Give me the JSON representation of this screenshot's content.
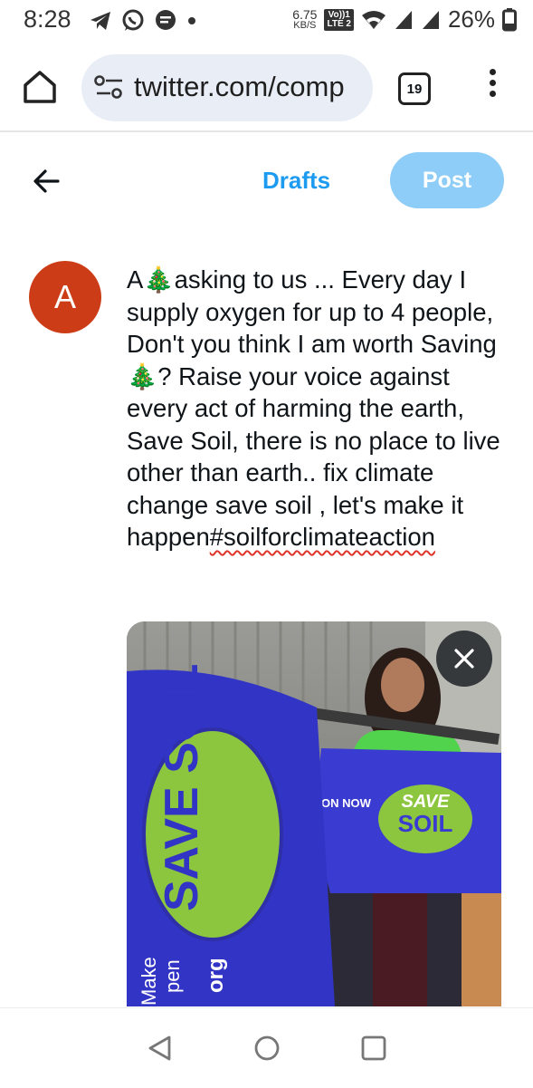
{
  "status_bar": {
    "time": "8:28",
    "net_speed_value": "6.75",
    "net_speed_unit": "KB/S",
    "lte_top": "Vo))1",
    "lte_bottom": "LTE 2",
    "battery": "26%",
    "left_icons": [
      "telegram-icon",
      "whatsapp-icon",
      "message-icon",
      "dot-icon"
    ],
    "right_icons": [
      "wifi-icon",
      "signal-icon",
      "signal-icon",
      "battery-icon"
    ]
  },
  "browser": {
    "url": "twitter.com/comp",
    "tab_count": "19"
  },
  "compose": {
    "drafts_label": "Drafts",
    "post_label": "Post",
    "avatar_letter": "A",
    "text_part1": "A🎄asking to us ... Every day I supply oxygen for up to 4 people, Don't you think I am worth Saving🎄? Raise your voice against every act of harming the earth, Save Soil, there is no place to live other than earth.. fix climate change save soil , let's make it happen",
    "hashtag": "#soilforclimateaction"
  },
  "media": {
    "flag_left_text": "SAVE SOIL",
    "flag_right_line1": "SAVE",
    "flag_right_line2": "SOIL",
    "flag_right_label": "ON NOW",
    "flag_left_footer": "org",
    "flag_left_footer2": "Make",
    "flag_left_footer3": "pen"
  },
  "colors": {
    "accent": "#1d9bf0",
    "post_disabled": "#8ecdf8",
    "avatar_bg": "#cc3d17",
    "flag_blue": "#3a3bd0",
    "flag_green": "#8cc63f"
  }
}
